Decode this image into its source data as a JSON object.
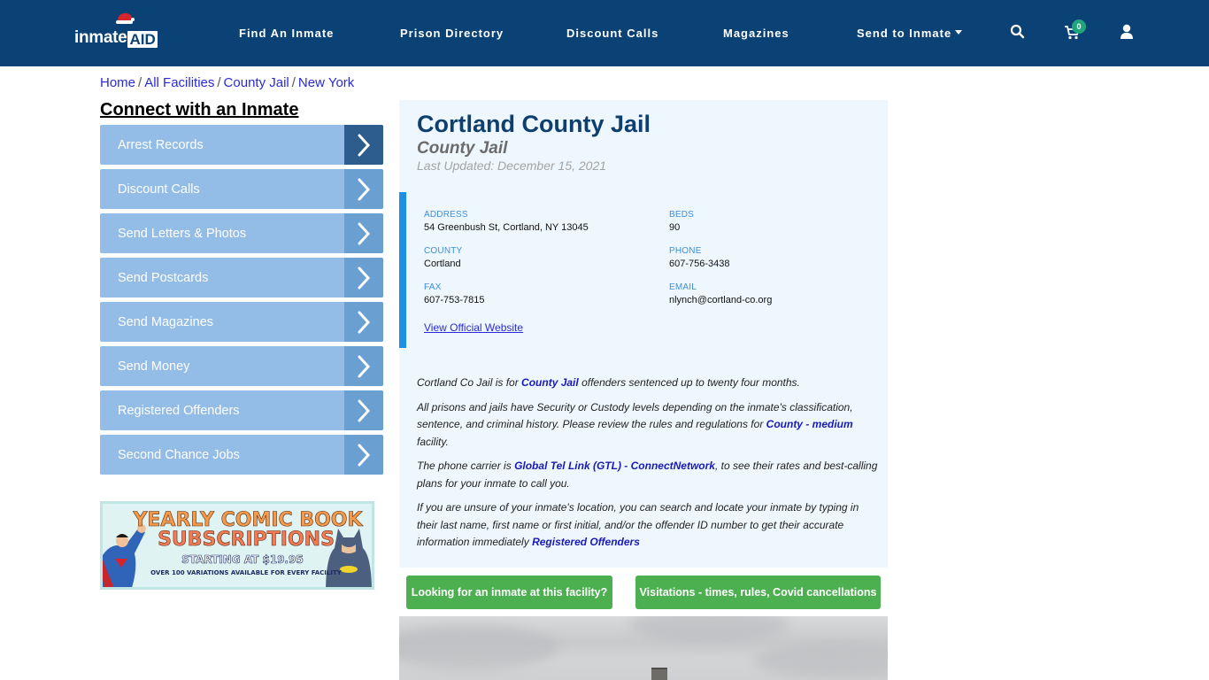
{
  "header": {
    "logo_text": "inmate",
    "logo_accent": "AID",
    "nav": [
      {
        "label": "Find An Inmate"
      },
      {
        "label": "Prison Directory"
      },
      {
        "label": "Discount Calls"
      },
      {
        "label": "Magazines"
      },
      {
        "label": "Send to Inmate",
        "has_dropdown": true
      }
    ],
    "icons": {
      "search": "search-icon",
      "cart": "cart-icon",
      "user": "user-icon"
    },
    "cart_count": "0",
    "colors": {
      "navbar": "#0b4275",
      "badge": "#20a67d"
    }
  },
  "breadcrumb": [
    {
      "label": "Home"
    },
    {
      "label": "All Facilities"
    },
    {
      "label": "County Jail"
    },
    {
      "label": "New York"
    }
  ],
  "sidebar": {
    "title": "Connect with an Inmate",
    "items": [
      {
        "label": "Arrest Records",
        "active": true
      },
      {
        "label": "Discount Calls"
      },
      {
        "label": "Send Letters & Photos"
      },
      {
        "label": "Send Postcards"
      },
      {
        "label": "Send Magazines"
      },
      {
        "label": "Send Money"
      },
      {
        "label": "Registered Offenders"
      },
      {
        "label": "Second Chance Jobs"
      }
    ],
    "banner": {
      "line1": "YEARLY COMIC BOOK",
      "line2": "SUBSCRIPTIONS",
      "line3": "STARTING AT $19.95",
      "line4": "OVER 100 VARIATIONS AVAILABLE FOR EVERY FACILITY"
    }
  },
  "facility": {
    "name": "Cortland County Jail",
    "type": "County Jail",
    "last_updated": "Last Updated: December 15, 2021",
    "fields": {
      "address": {
        "label": "ADDRESS",
        "value": "54 Greenbush St, Cortland, NY 13045"
      },
      "beds": {
        "label": "BEDS",
        "value": "90"
      },
      "county": {
        "label": "COUNTY",
        "value": "Cortland"
      },
      "phone": {
        "label": "PHONE",
        "value": "607-756-3438"
      },
      "fax": {
        "label": "FAX",
        "value": "607-753-7815"
      },
      "email": {
        "label": "EMAIL",
        "value": "nlynch@cortland-co.org"
      }
    },
    "website_link": "View Official Website",
    "description": {
      "p1_a": "Cortland Co Jail is for ",
      "p1_link": "County Jail",
      "p1_b": " offenders sentenced up to twenty four months.",
      "p2_a": "All prisons and jails have Security or Custody levels depending on the inmate's classification, sentence, and criminal history. Please review the rules and regulations for ",
      "p2_link": "County - medium",
      "p2_b": " facility.",
      "p3_a": "The phone carrier is ",
      "p3_link": "Global Tel Link (GTL) - ConnectNetwork",
      "p3_b": ", to see their rates and best-calling plans for your inmate to call you.",
      "p4_a": "If you are unsure of your inmate's location, you can search and locate your inmate by typing in their last name, first name or first initial, and/or the offender ID number to get their accurate information immediately ",
      "p4_link": "Registered Offenders"
    }
  },
  "buttons": {
    "find_inmate": "Looking for an inmate at this facility?",
    "visitations": "Visitations - times, rules, Covid cancellations"
  }
}
